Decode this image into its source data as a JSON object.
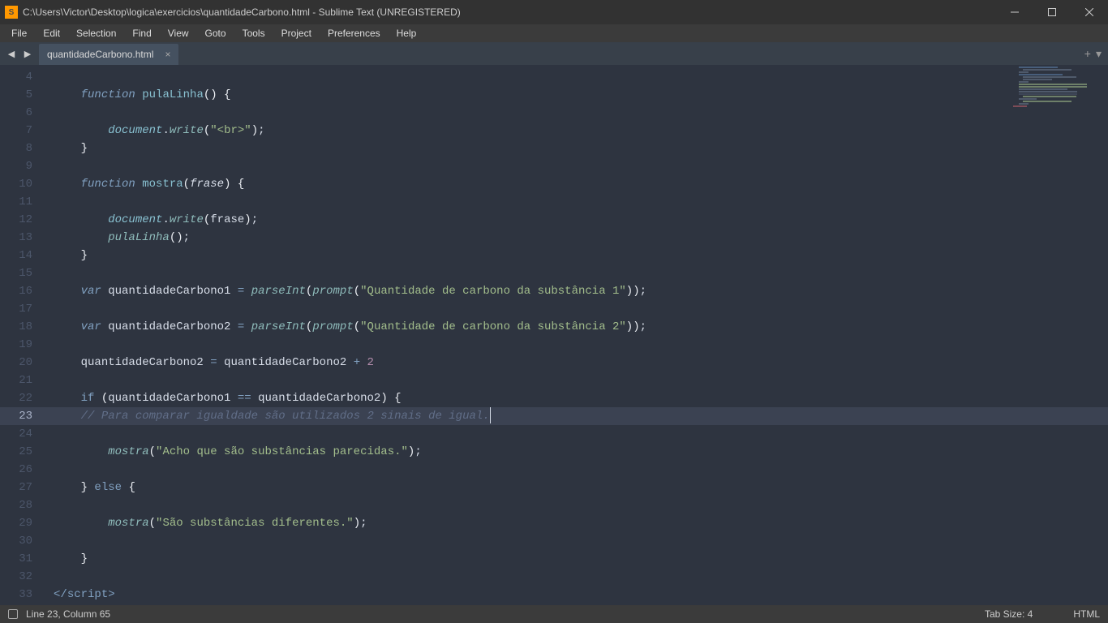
{
  "titlebar": {
    "app_icon": "S",
    "title": "C:\\Users\\Victor\\Desktop\\logica\\exercicios\\quantidadeCarbono.html - Sublime Text (UNREGISTERED)"
  },
  "menu": [
    "File",
    "Edit",
    "Selection",
    "Find",
    "View",
    "Goto",
    "Tools",
    "Project",
    "Preferences",
    "Help"
  ],
  "tab": {
    "name": "quantidadeCarbono.html"
  },
  "tabbar_right": {
    "plus": "+",
    "menu": "▾"
  },
  "gutter": {
    "start": 4,
    "end": 33,
    "active": 23
  },
  "code": {
    "l5_fn": "function",
    "l5_name": "pulaLinha",
    "l7_obj": "document",
    "l7_write": "write",
    "l7_str": "\"<br>\"",
    "l10_fn": "function",
    "l10_name": "mostra",
    "l10_param": "frase",
    "l12_obj": "document",
    "l12_write": "write",
    "l12_arg": "frase",
    "l13_call": "pulaLinha",
    "l16_var": "var",
    "l16_id": "quantidadeCarbono1",
    "l16_pi": "parseInt",
    "l16_pr": "prompt",
    "l16_str": "\"Quantidade de carbono da substância 1\"",
    "l18_var": "var",
    "l18_id": "quantidadeCarbono2",
    "l18_pi": "parseInt",
    "l18_pr": "prompt",
    "l18_str": "\"Quantidade de carbono da substância 2\"",
    "l20_lhs": "quantidadeCarbono2",
    "l20_rhs": "quantidadeCarbono2",
    "l20_num": "2",
    "l22_if": "if",
    "l22_a": "quantidadeCarbono1",
    "l22_b": "quantidadeCarbono2",
    "l23_comment": "// Para comparar igualdade são utilizados 2 sinais de igual.",
    "l25_call": "mostra",
    "l25_str": "\"Acho que são substâncias parecidas.\"",
    "l27_else": "else",
    "l29_call": "mostra",
    "l29_str": "\"São substâncias diferentes.\"",
    "l33_close_open": "</",
    "l33_tag": "script",
    "l33_close": ">"
  },
  "status": {
    "pos": "Line 23, Column 65",
    "tabsize": "Tab Size: 4",
    "syntax": "HTML"
  }
}
